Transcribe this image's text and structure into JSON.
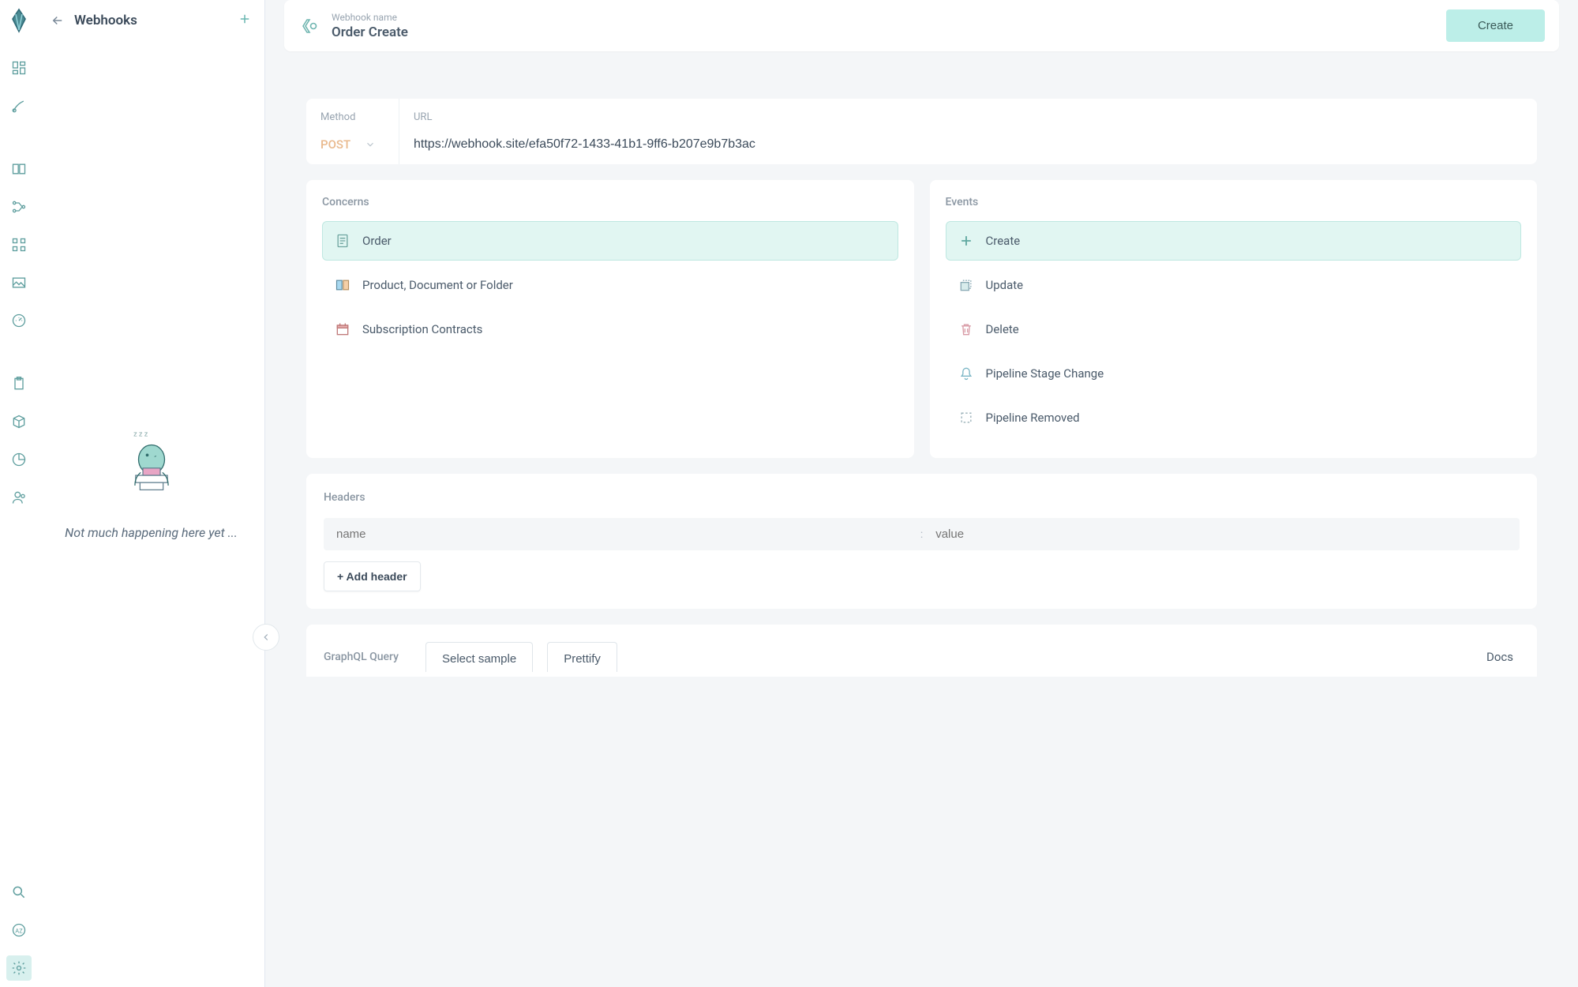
{
  "sidebar": {
    "title": "Webhooks",
    "empty_message": "Not much happening here yet ..."
  },
  "rail_icons": [
    "grid-icon",
    "brush-icon",
    "book-icon",
    "nodes-icon",
    "apps-icon",
    "image-icon",
    "gauge-icon",
    "clipboard-icon",
    "cube-icon",
    "piechart-icon",
    "user-icon",
    "search-icon",
    "translate-icon",
    "settings-icon"
  ],
  "header": {
    "label": "Webhook name",
    "value": "Order Create",
    "create_button": "Create"
  },
  "method": {
    "label": "Method",
    "value": "POST"
  },
  "url_section": {
    "label": "URL",
    "value": "https://webhook.site/efa50f72-1433-41b1-9ff6-b207e9b7b3ac"
  },
  "concerns": {
    "title": "Concerns",
    "options": [
      {
        "label": "Order",
        "selected": true,
        "icon": "order-doc-icon"
      },
      {
        "label": "Product, Document or Folder",
        "selected": false,
        "icon": "book-color-icon"
      },
      {
        "label": "Subscription Contracts",
        "selected": false,
        "icon": "calendar-icon"
      }
    ]
  },
  "events": {
    "title": "Events",
    "options": [
      {
        "label": "Create",
        "selected": true,
        "icon": "plus-square-icon"
      },
      {
        "label": "Update",
        "selected": false,
        "icon": "update-icon"
      },
      {
        "label": "Delete",
        "selected": false,
        "icon": "trash-icon"
      },
      {
        "label": "Pipeline Stage Change",
        "selected": false,
        "icon": "bell-icon"
      },
      {
        "label": "Pipeline Removed",
        "selected": false,
        "icon": "dashed-square-icon"
      }
    ]
  },
  "headers": {
    "title": "Headers",
    "name_placeholder": "name",
    "colon": ":",
    "value_placeholder": "value",
    "add_button": "+ Add header"
  },
  "graphql": {
    "title": "GraphQL Query",
    "select_sample": "Select sample",
    "prettify": "Prettify",
    "docs": "Docs"
  }
}
